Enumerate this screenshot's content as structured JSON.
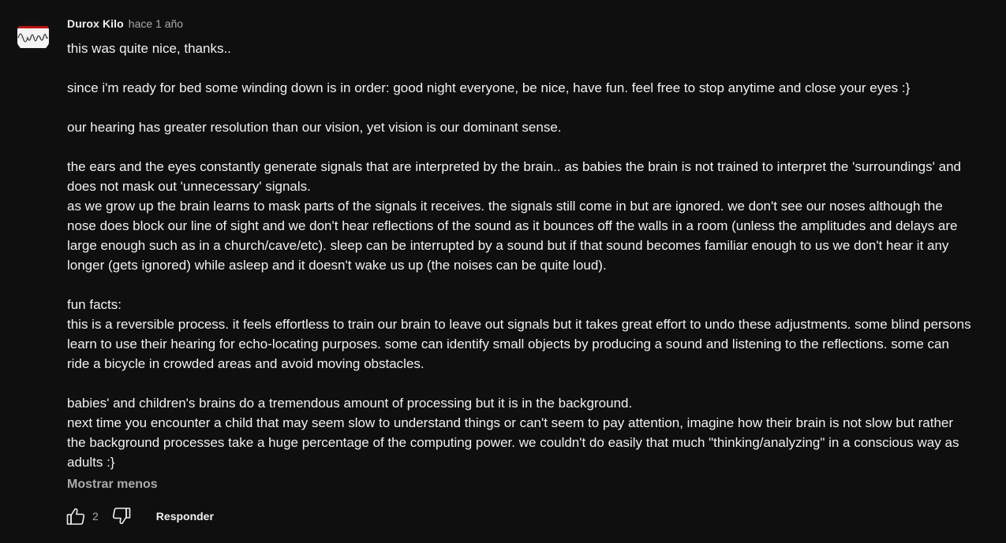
{
  "comment": {
    "author": "Durox Kilo",
    "time": "hace 1 año",
    "text": "this was quite nice, thanks..\n\nsince i'm ready for bed some winding down is in order: good night everyone, be nice, have fun. feel free to stop anytime and close your eyes :}\n\nour hearing has greater resolution than our vision, yet vision is our dominant sense.\n\nthe ears and the eyes constantly generate signals that are interpreted by the brain.. as babies the brain is not trained to interpret the 'surroundings' and does not mask out 'unnecessary' signals.\nas we grow up the brain learns to mask parts of the signals it receives. the signals still come in but are ignored. we don't see our noses although the nose does block our line of sight and we don't hear reflections of the sound as it bounces off the walls in a room (unless the amplitudes and delays are large enough such as in a church/cave/etc). sleep can be interrupted by a sound but if that sound becomes familiar enough to us we don't hear it any longer (gets ignored) while asleep and it doesn't wake us up (the noises can be quite loud).\n\nfun facts:\nthis is a reversible process. it feels effortless to train our brain to leave out signals but it takes great effort to undo these adjustments. some blind persons learn to use their hearing for echo-locating purposes. some can identify small objects by producing a sound and listening to the reflections. some can ride a bicycle in crowded areas and avoid moving obstacles.\n\nbabies' and children's brains do a tremendous amount of processing but it is in the background.\nnext time you encounter a child that may seem slow to understand things or can't seem to pay attention, imagine how their brain is not slow but rather the background processes take a huge percentage of the computing power. we couldn't do easily that much \"thinking/analyzing\" in a conscious way as adults :}",
    "show_less": "Mostrar menos",
    "like_count": "2",
    "reply_label": "Responder"
  },
  "icons": {
    "avatar": "waveform-avatar-icon",
    "like": "thumbs-up-icon",
    "dislike": "thumbs-down-icon"
  },
  "colors": {
    "background": "#0f0f0f",
    "text": "#f1f1f1",
    "secondary_text": "#aaaaaa"
  }
}
